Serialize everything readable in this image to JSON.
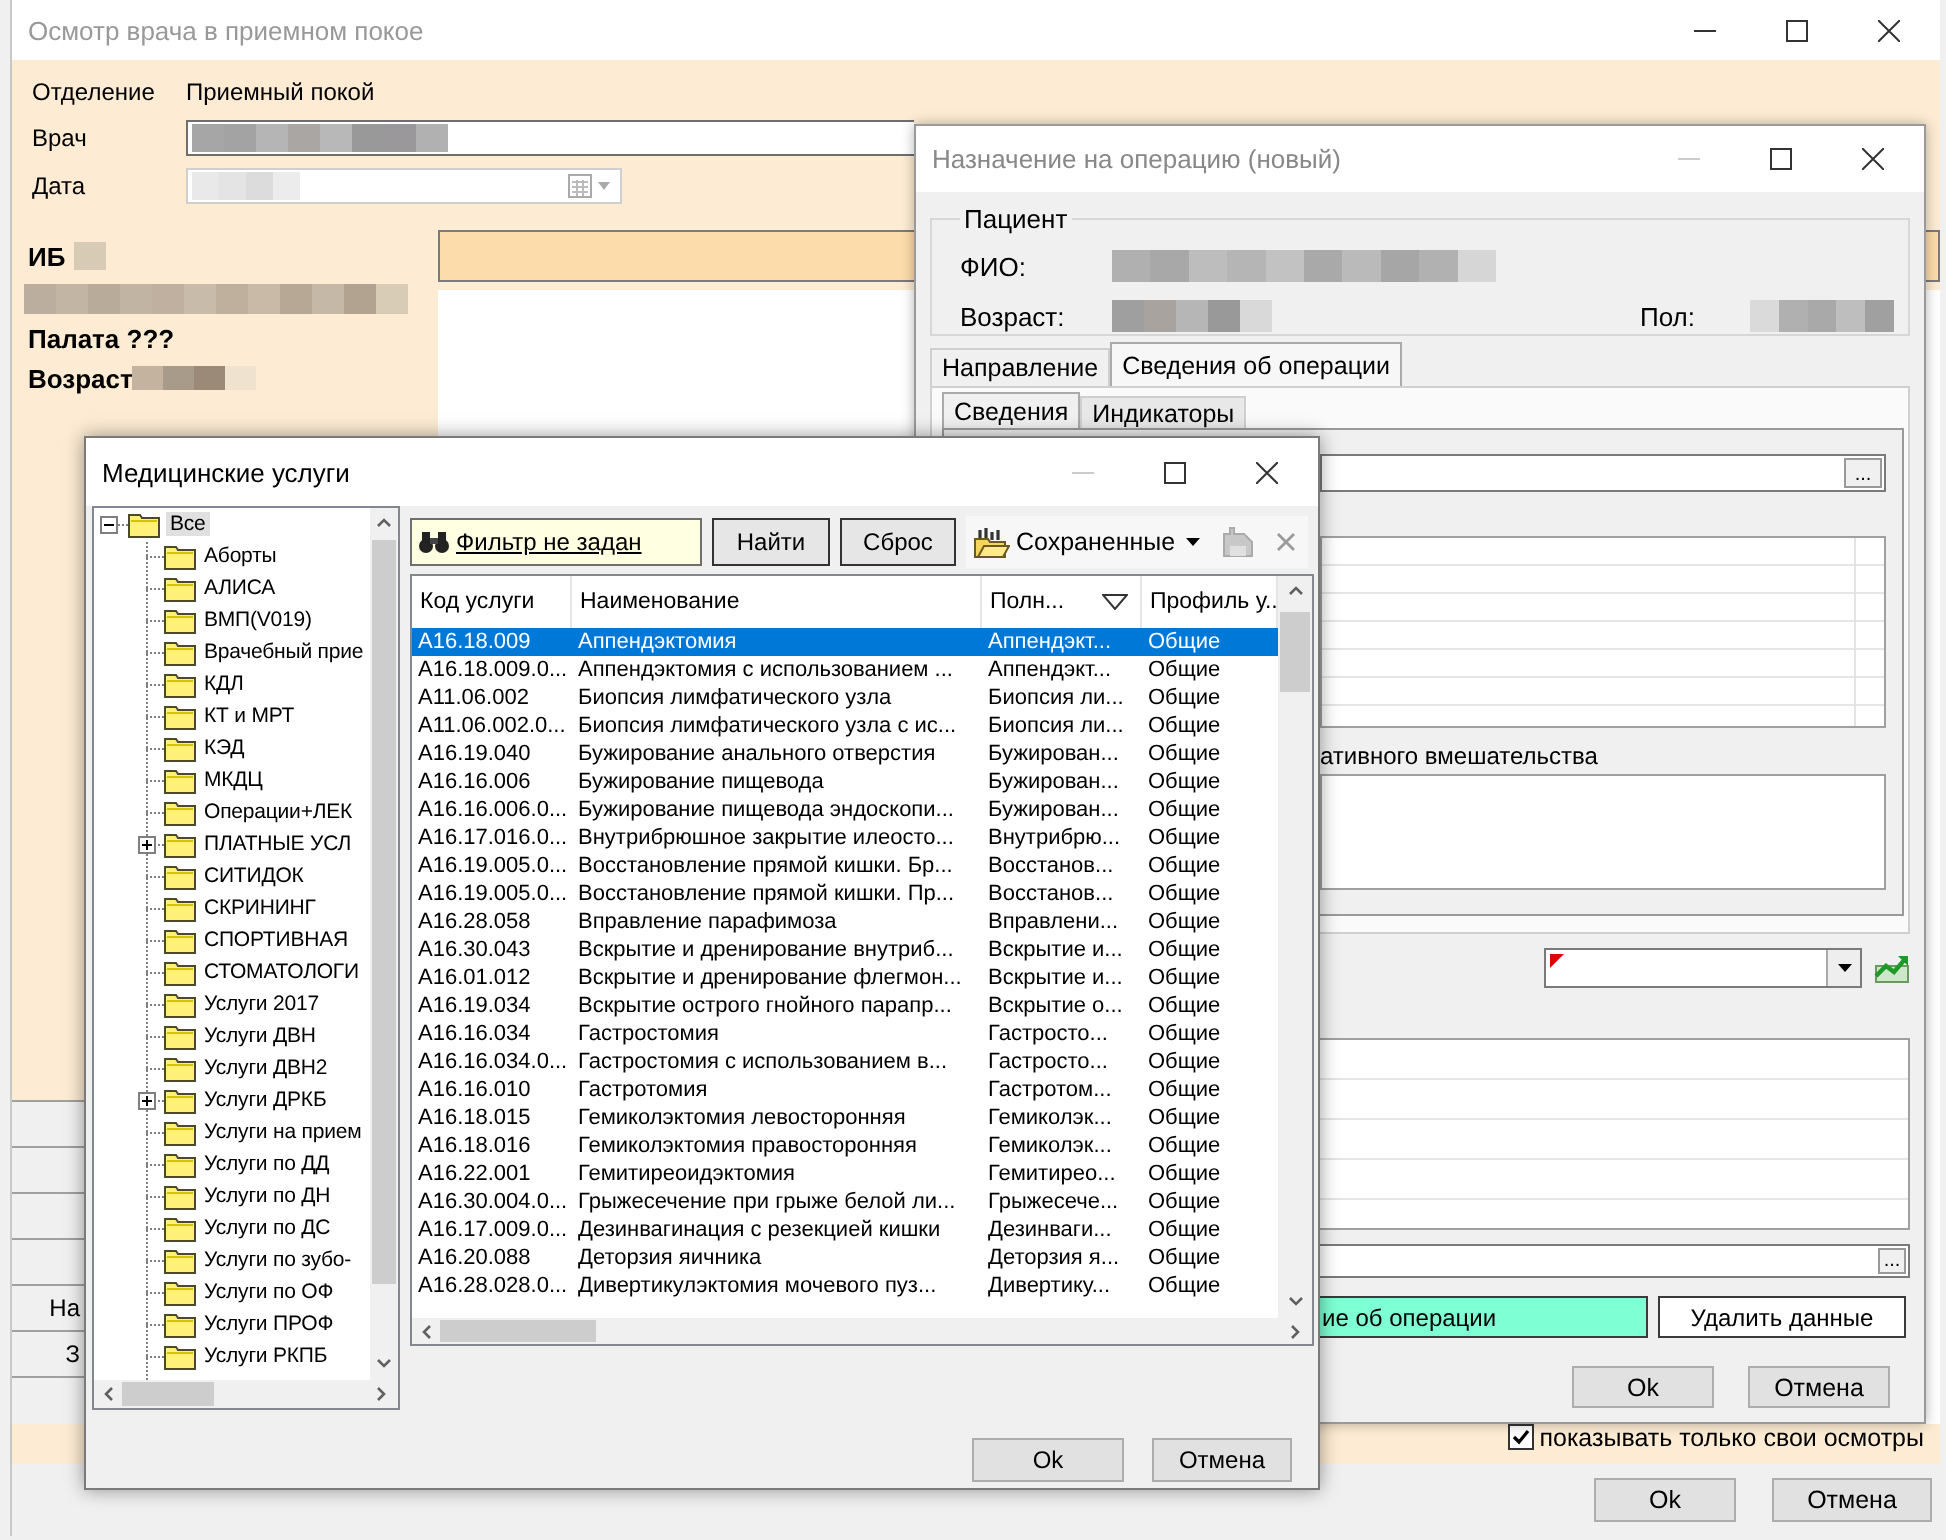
{
  "exam_window": {
    "title": "Осмотр врача в приемном покое",
    "department_label": "Отделение",
    "department_value": "Приемный покой",
    "doctor_label": "Врач",
    "date_label": "Дата",
    "ib_label": "ИБ",
    "ward_label": "Палата ???",
    "age_label": "Возраст",
    "grid_cells": [
      "На",
      "З"
    ],
    "show_own_only": {
      "label": "показывать только свои осмотры",
      "checked": true
    },
    "buttons": [
      "Ok",
      "Отмена"
    ]
  },
  "operation_window": {
    "title": "Назначение на операцию (новый)",
    "patient_group": "Пациент",
    "name_label": "ФИО:",
    "age_label": "Возраст:",
    "sex_label": "Пол:",
    "tabs": [
      {
        "label": "Направление",
        "selected": false
      },
      {
        "label": "Сведения об операции",
        "selected": true
      }
    ],
    "subtabs": [
      {
        "label": "Сведения",
        "selected": true
      },
      {
        "label": "Индикаторы",
        "selected": false
      }
    ],
    "browse_buttons": [
      "...",
      "..."
    ],
    "intervention_label": "ативного вмешательства",
    "save_button": "ие об операции",
    "delete_button": "Удалить данные",
    "buttons": [
      "Ok",
      "Отмена"
    ]
  },
  "services_window": {
    "title": "Медицинские услуги",
    "tree": {
      "label": "Все",
      "expanded": true,
      "selected": true,
      "children": [
        {
          "label": "Аборты",
          "expandable": false
        },
        {
          "label": "АЛИСА",
          "expandable": false
        },
        {
          "label": "ВМП(V019)",
          "expandable": false
        },
        {
          "label": "Врачебный прие",
          "expandable": false
        },
        {
          "label": "КДЛ",
          "expandable": false
        },
        {
          "label": "КТ и МРТ",
          "expandable": false
        },
        {
          "label": "КЭД",
          "expandable": false
        },
        {
          "label": "МКДЦ",
          "expandable": false
        },
        {
          "label": "Операции+ЛЕК",
          "expandable": false
        },
        {
          "label": "ПЛАТНЫЕ УСЛ",
          "expandable": true
        },
        {
          "label": "СИТИДОК",
          "expandable": false
        },
        {
          "label": "СКРИНИНГ",
          "expandable": false
        },
        {
          "label": "СПОРТИВНАЯ",
          "expandable": false
        },
        {
          "label": "СТОМАТОЛОГИ",
          "expandable": false
        },
        {
          "label": "Услуги 2017",
          "expandable": false
        },
        {
          "label": "Услуги ДВН",
          "expandable": false
        },
        {
          "label": "Услуги ДВН2",
          "expandable": false
        },
        {
          "label": "Услуги ДРКБ",
          "expandable": true
        },
        {
          "label": "Услуги на прием",
          "expandable": false
        },
        {
          "label": "Услуги по ДД",
          "expandable": false
        },
        {
          "label": "Услуги по ДН",
          "expandable": false
        },
        {
          "label": "Услуги по ДС",
          "expandable": false
        },
        {
          "label": "Услуги по зубо-",
          "expandable": false
        },
        {
          "label": "Услуги по ОФ",
          "expandable": false
        },
        {
          "label": "Услуги ПРОФ",
          "expandable": false
        },
        {
          "label": "Услуги РКПБ",
          "expandable": false
        }
      ]
    },
    "filter_link": "Фильтр не задан",
    "find_button": "Найти",
    "reset_button": "Сброс",
    "saved_button": "Сохраненные",
    "columns": [
      "Код услуги",
      "Наименование",
      "Полн...",
      "Профиль у..."
    ],
    "rows": [
      {
        "code": "A16.18.009",
        "name": "Аппендэктомия",
        "full": "Аппендэкт...",
        "profile": "Общие",
        "selected": true
      },
      {
        "code": "A16.18.009.0...",
        "name": "Аппендэктомия с использованием ...",
        "full": "Аппендэкт...",
        "profile": "Общие",
        "selected": false
      },
      {
        "code": "A11.06.002",
        "name": "Биопсия лимфатического узла",
        "full": "Биопсия ли...",
        "profile": "Общие",
        "selected": false
      },
      {
        "code": "A11.06.002.0...",
        "name": "Биопсия лимфатического узла с ис...",
        "full": "Биопсия ли...",
        "profile": "Общие",
        "selected": false
      },
      {
        "code": "A16.19.040",
        "name": "Бужирование анального отверстия",
        "full": "Бужирован...",
        "profile": "Общие",
        "selected": false
      },
      {
        "code": "A16.16.006",
        "name": "Бужирование пищевода",
        "full": "Бужирован...",
        "profile": "Общие",
        "selected": false
      },
      {
        "code": "A16.16.006.0...",
        "name": "Бужирование пищевода эндоскопи...",
        "full": "Бужирован...",
        "profile": "Общие",
        "selected": false
      },
      {
        "code": "A16.17.016.0...",
        "name": "Внутрибрюшное закрытие илеосто...",
        "full": "Внутрибрю...",
        "profile": "Общие",
        "selected": false
      },
      {
        "code": "A16.19.005.0...",
        "name": "Восстановление прямой кишки. Бр...",
        "full": "Восстанов...",
        "profile": "Общие",
        "selected": false
      },
      {
        "code": "A16.19.005.0...",
        "name": "Восстановление прямой кишки. Пр...",
        "full": "Восстанов...",
        "profile": "Общие",
        "selected": false
      },
      {
        "code": "A16.28.058",
        "name": "Вправление парафимоза",
        "full": "Вправлени...",
        "profile": "Общие",
        "selected": false
      },
      {
        "code": "A16.30.043",
        "name": "Вскрытие и дренирование внутриб...",
        "full": "Вскрытие и...",
        "profile": "Общие",
        "selected": false
      },
      {
        "code": "A16.01.012",
        "name": "Вскрытие и дренирование флегмон...",
        "full": "Вскрытие и...",
        "profile": "Общие",
        "selected": false
      },
      {
        "code": "A16.19.034",
        "name": "Вскрытие острого гнойного парапр...",
        "full": "Вскрытие о...",
        "profile": "Общие",
        "selected": false
      },
      {
        "code": "A16.16.034",
        "name": "Гастростомия",
        "full": "Гастросто...",
        "profile": "Общие",
        "selected": false
      },
      {
        "code": "A16.16.034.0...",
        "name": "Гастростомия с использованием в...",
        "full": "Гастросто...",
        "profile": "Общие",
        "selected": false
      },
      {
        "code": "A16.16.010",
        "name": "Гастротомия",
        "full": "Гастротом...",
        "profile": "Общие",
        "selected": false
      },
      {
        "code": "A16.18.015",
        "name": "Гемиколэктомия левосторонняя",
        "full": "Гемиколэк...",
        "profile": "Общие",
        "selected": false
      },
      {
        "code": "A16.18.016",
        "name": "Гемиколэктомия правосторонняя",
        "full": "Гемиколэк...",
        "profile": "Общие",
        "selected": false
      },
      {
        "code": "A16.22.001",
        "name": "Гемитиреоидэктомия",
        "full": "Гемитирео...",
        "profile": "Общие",
        "selected": false
      },
      {
        "code": "A16.30.004.0...",
        "name": "Грыжесечение при грыже белой ли...",
        "full": "Грыжесече...",
        "profile": "Общие",
        "selected": false
      },
      {
        "code": "A16.17.009.0...",
        "name": "Дезинвагинация с резекцией кишки",
        "full": "Дезинваги...",
        "profile": "Общие",
        "selected": false
      },
      {
        "code": "A16.20.088",
        "name": "Деторзия яичника",
        "full": "Деторзия я...",
        "profile": "Общие",
        "selected": false
      },
      {
        "code": "A16.28.028.0...",
        "name": "Дивертикулэктомия мочевого пуз...",
        "full": "Дивертику...",
        "profile": "Общие",
        "selected": false
      }
    ],
    "buttons": [
      "Ok",
      "Отмена"
    ]
  }
}
